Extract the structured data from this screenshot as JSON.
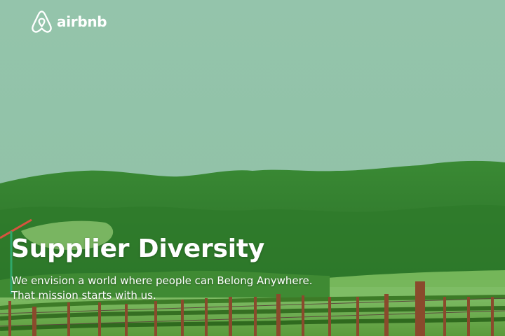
{
  "brand": {
    "name": "airbnb",
    "icon": "airbnb-belo-icon"
  },
  "hero": {
    "title": "Supplier Diversity",
    "subtitle_line1": "We envision a world where people can Belong Anywhere.",
    "subtitle_line2": "That mission starts with us."
  },
  "colors": {
    "sky": "#93c5aa",
    "hills": "#2f7d2d",
    "vines": "#4f8e2e",
    "posts": "#8a4a2c",
    "text": "#ffffff"
  }
}
